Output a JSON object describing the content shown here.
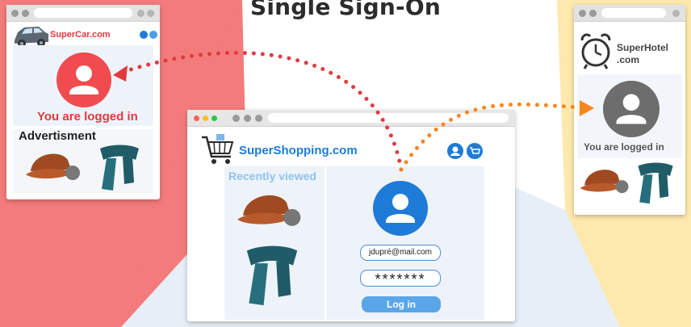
{
  "title": "Single Sign-On",
  "supercar": {
    "brand": "SuperCar.com",
    "status": "You are logged in",
    "ad_heading": "Advertisment"
  },
  "supershopping": {
    "brand": "SuperShopping.com",
    "recently_viewed": "Recently viewed",
    "email": "jdupré@mail.com",
    "password": "*******",
    "login": "Log in"
  },
  "superhotel": {
    "brand_line1": "SuperHotel",
    "brand_line2": ".com",
    "status": "You are logged in"
  },
  "colors": {
    "red_bg": "#f47b7b",
    "yellow_bg": "#fde9ae",
    "blue_bg": "#e6eef7",
    "red_accent": "#e23a3f",
    "orange_accent": "#f7861f",
    "blue_accent": "#1f7bd8",
    "gray_avatar": "#6d6d6d"
  }
}
